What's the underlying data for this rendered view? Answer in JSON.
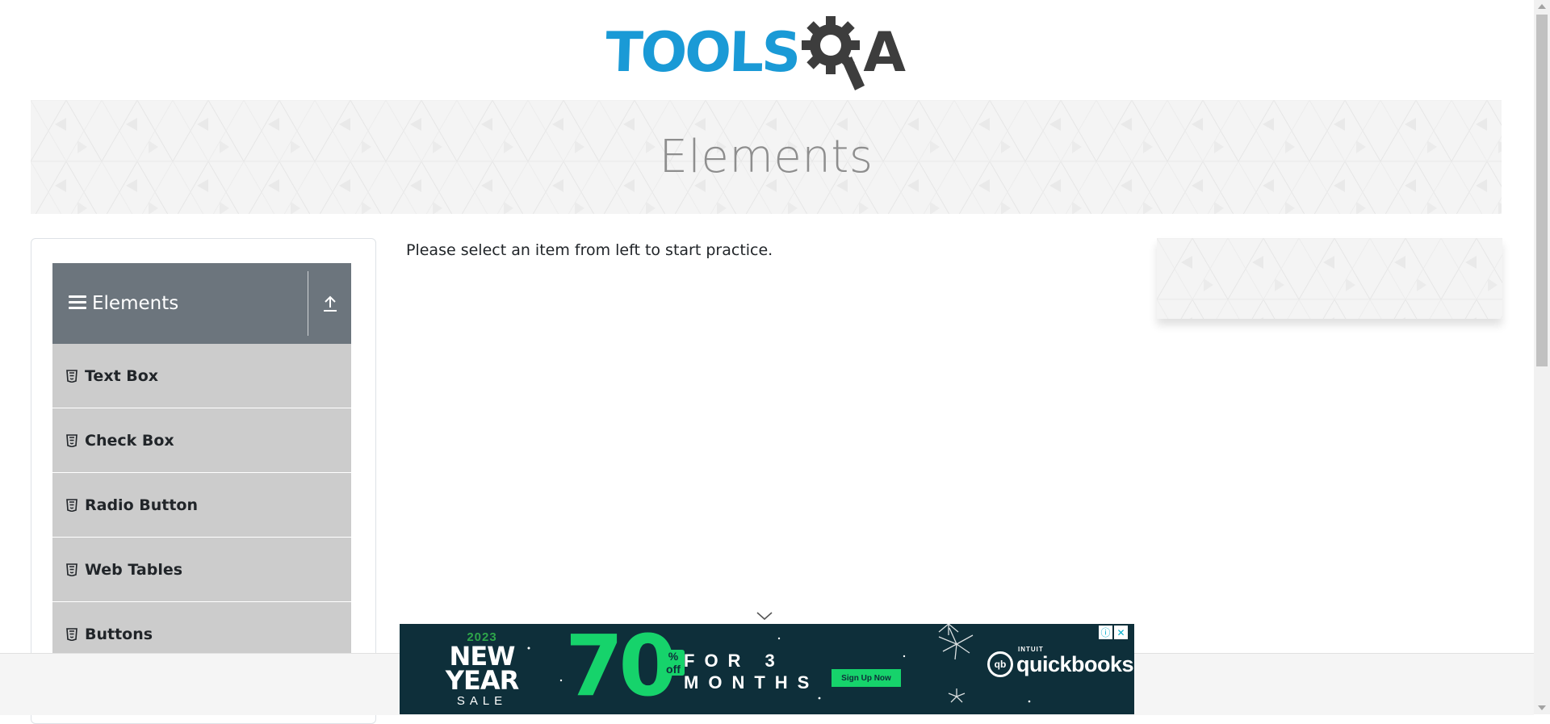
{
  "header": {
    "logo_tools": "TOOLS",
    "logo_a": "A",
    "colors": {
      "tools_blue": "#1a9ad6",
      "qa_dark": "#3d3d3d"
    }
  },
  "banner": {
    "title": "Elements"
  },
  "sidebar": {
    "group": {
      "title": "Elements",
      "icon": "hamburger-icon",
      "toggle_icon": "collapse-up-arrow-icon",
      "header_color": "#6c757d"
    },
    "items": [
      {
        "label": "Text Box",
        "icon": "html5-icon"
      },
      {
        "label": "Check Box",
        "icon": "html5-icon"
      },
      {
        "label": "Radio Button",
        "icon": "html5-icon"
      },
      {
        "label": "Web Tables",
        "icon": "html5-icon"
      },
      {
        "label": "Buttons",
        "icon": "html5-icon"
      }
    ],
    "item_color": "#cccccc"
  },
  "main": {
    "message": "Please select an item from left to start practice."
  },
  "ad": {
    "year": "2023",
    "line1": "NEW",
    "line2": "YEAR",
    "line3": "SALE",
    "discount": "70",
    "discount_suffix": "% off",
    "offer_line1": "FOR 3",
    "offer_line2": "MONTHS",
    "cta": "Sign Up Now",
    "brand_prefix": "INTUIT",
    "brand": "quickbooks",
    "brand_mark": "qb",
    "info_icon": "info-icon",
    "close_icon": "close-icon",
    "colors": {
      "background": "#0e2f3a",
      "accent": "#16d36b"
    }
  }
}
